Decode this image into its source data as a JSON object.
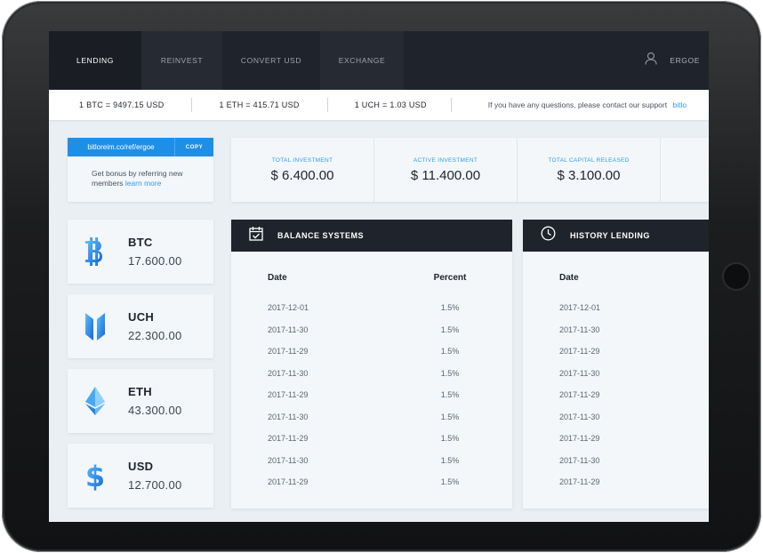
{
  "nav": {
    "tabs": [
      "LENDING",
      "REINVEST",
      "CONVERT USD",
      "EXCHANGE"
    ],
    "user": "ERGOE"
  },
  "rates": {
    "btc": "1 BTC = 9497.15 USD",
    "eth": "1 ETH = 415.71 USD",
    "uch": "1 UCH = 1.03 USD",
    "support_text": "If you have any questions, please contact our support",
    "support_link": "bitlo"
  },
  "referral": {
    "url": "bitloreim.co/ref/ergoe",
    "copy_label": "COPY",
    "text": "Get bonus by referring new members",
    "link": "learn more"
  },
  "stats": [
    {
      "label": "TOTAL INVESTMENT",
      "value": "$ 6.400.00"
    },
    {
      "label": "ACTIVE INVESTMENT",
      "value": "$ 11.400.00"
    },
    {
      "label": "TOTAL CAPITAL RELEASED",
      "value": "$ 3.100.00"
    },
    {
      "label": "",
      "value": "$"
    }
  ],
  "coins": [
    {
      "name": "BTC",
      "value": "17.600.00",
      "icon": "bitcoin-icon"
    },
    {
      "name": "UCH",
      "value": "22.300.00",
      "icon": "uch-icon"
    },
    {
      "name": "ETH",
      "value": "43.300.00",
      "icon": "ethereum-icon"
    },
    {
      "name": "USD",
      "value": "12.700.00",
      "icon": "dollar-icon"
    }
  ],
  "balance": {
    "title": "BALANCE SYSTEMS",
    "headers": [
      "Date",
      "Percent"
    ],
    "rows": [
      [
        "2017-12-01",
        "1.5%"
      ],
      [
        "2017-11-30",
        "1.5%"
      ],
      [
        "2017-11-29",
        "1.5%"
      ],
      [
        "2017-11-30",
        "1.5%"
      ],
      [
        "2017-11-29",
        "1.5%"
      ],
      [
        "2017-11-30",
        "1.5%"
      ],
      [
        "2017-11-29",
        "1.5%"
      ],
      [
        "2017-11-30",
        "1.5%"
      ],
      [
        "2017-11-29",
        "1.5%"
      ]
    ]
  },
  "history": {
    "title": "HISTORY LENDING",
    "headers": [
      "Date"
    ],
    "rows": [
      "2017-12-01",
      "2017-11-30",
      "2017-11-29",
      "2017-11-30",
      "2017-11-29",
      "2017-11-30",
      "2017-11-29",
      "2017-11-30",
      "2017-11-29"
    ]
  },
  "colors": {
    "accent": "#2f9bea",
    "dark": "#1f232b"
  }
}
